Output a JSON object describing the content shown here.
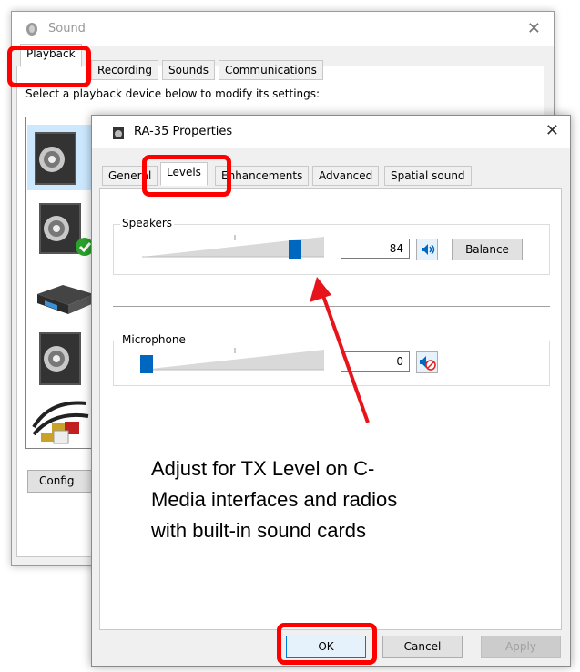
{
  "sound_window": {
    "title": "Sound",
    "tabs": [
      "Playback",
      "Recording",
      "Sounds",
      "Communications"
    ],
    "active_tab": "Playback",
    "hint": "Select a playback device below to modify its settings:",
    "configure_label": "Config"
  },
  "props_window": {
    "title": "RA-35 Properties",
    "tabs": [
      "General",
      "Levels",
      "Enhancements",
      "Advanced",
      "Spatial sound"
    ],
    "active_tab": "Levels",
    "speakers": {
      "label": "Speakers",
      "value": "84",
      "level": 84,
      "balance_label": "Balance",
      "muted": false
    },
    "microphone": {
      "label": "Microphone",
      "value": "0",
      "level": 0,
      "muted": true
    },
    "buttons": {
      "ok": "OK",
      "cancel": "Cancel",
      "apply": "Apply"
    }
  },
  "annotation": {
    "lines": [
      "Adjust for TX Level on C-",
      "Media interfaces and radios",
      "with built-in sound cards"
    ]
  },
  "colors": {
    "highlight": "#ff0000",
    "accent": "#0067c0",
    "arrow": "#e8141b"
  }
}
